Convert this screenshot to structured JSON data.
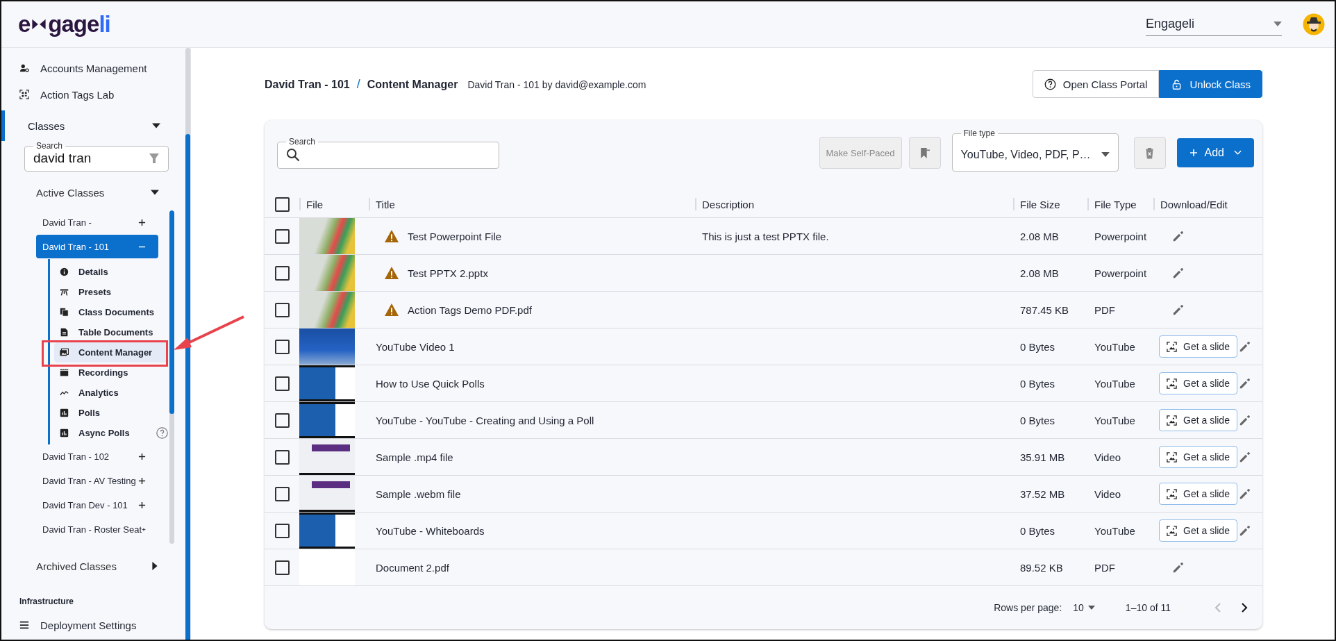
{
  "header": {
    "logo": {
      "start": "e",
      "middle": "gage",
      "end": "li"
    },
    "org_select": {
      "value": "Engageli"
    }
  },
  "sidebar": {
    "nav_items": [
      {
        "label": "Accounts Management"
      },
      {
        "label": "Action Tags Lab"
      }
    ],
    "classes": {
      "label": "Classes",
      "expanded": true,
      "selected": true,
      "search": {
        "label": "Search",
        "value": "david tran"
      },
      "active": {
        "label": "Active Classes",
        "expanded": true,
        "items": [
          {
            "label": "David Tran -",
            "expanded": false,
            "selected": false
          },
          {
            "label": "David Tran - 101",
            "expanded": true,
            "selected": true,
            "children": [
              {
                "label": "Details",
                "selected": false,
                "help": false
              },
              {
                "label": "Presets",
                "selected": false,
                "help": false
              },
              {
                "label": "Class Documents",
                "selected": false,
                "help": false
              },
              {
                "label": "Table Documents",
                "selected": false,
                "help": false
              },
              {
                "label": "Content Manager",
                "selected": true,
                "help": false
              },
              {
                "label": "Recordings",
                "selected": false,
                "help": false
              },
              {
                "label": "Analytics",
                "selected": false,
                "help": false
              },
              {
                "label": "Polls",
                "selected": false,
                "help": false
              },
              {
                "label": "Async Polls",
                "selected": false,
                "help": true
              }
            ]
          },
          {
            "label": "David Tran - 102",
            "expanded": false,
            "selected": false
          },
          {
            "label": "David Tran - AV Testing",
            "expanded": false,
            "selected": false
          },
          {
            "label": "David Tran Dev - 101",
            "expanded": false,
            "selected": false
          },
          {
            "label": "David Tran - Roster Seat",
            "expanded": false,
            "selected": false
          }
        ]
      },
      "archived": {
        "label": "Archived Classes",
        "expanded": false
      }
    },
    "section_heading": "Infrastructure",
    "bottom_items": [
      {
        "label": "Deployment Settings"
      }
    ]
  },
  "breadcrumb": {
    "parent": "David Tran - 101",
    "separator": "/",
    "current": "Content Manager",
    "subtitle": "David Tran - 101 by david@example.com"
  },
  "header_buttons": {
    "open_portal": "Open Class Portal",
    "unlock": "Unlock Class"
  },
  "toolbar": {
    "search": {
      "label": "Search"
    },
    "self_paced": {
      "label": "Make Self-Paced",
      "disabled": true
    },
    "file_type": {
      "label": "File type",
      "value": "YouTube, Video, PDF, P…"
    },
    "add": "Add"
  },
  "table": {
    "all_checked": false,
    "columns": [
      "File",
      "Title",
      "Description",
      "File Size",
      "File Type",
      "Download/Edit"
    ],
    "rows": [
      {
        "checked": false,
        "kind": "candy",
        "warning": true,
        "title": "Test Powerpoint File",
        "description": "This is just a test PPTX file.",
        "size": "2.08 MB",
        "type": "Powerpoint"
      },
      {
        "checked": false,
        "kind": "candy",
        "warning": true,
        "title": "Test PPTX 2.pptx",
        "size": "2.08 MB",
        "type": "Powerpoint"
      },
      {
        "checked": false,
        "kind": "candy",
        "warning": true,
        "title": "Action Tags Demo PDF.pdf",
        "size": "787.45 KB",
        "type": "PDF"
      },
      {
        "checked": false,
        "kind": "news",
        "warning": false,
        "title": "YouTube Video 1",
        "size": "0 Bytes",
        "type": "YouTube",
        "slide_button": "Get a slide"
      },
      {
        "checked": false,
        "kind": "slides",
        "warning": false,
        "title": "How to Use Quick Polls",
        "size": "0 Bytes",
        "type": "YouTube",
        "slide_button": "Get a slide"
      },
      {
        "checked": false,
        "kind": "slides",
        "warning": false,
        "title": "YouTube - YouTube - Creating and Using a Poll",
        "size": "0 Bytes",
        "type": "YouTube",
        "slide_button": "Get a slide"
      },
      {
        "checked": false,
        "kind": "screen",
        "warning": false,
        "title": "Sample .mp4 file",
        "size": "35.91 MB",
        "type": "Video",
        "slide_button": "Get a slide"
      },
      {
        "checked": false,
        "kind": "screen",
        "warning": false,
        "title": "Sample .webm file",
        "size": "37.52 MB",
        "type": "Video",
        "slide_button": "Get a slide"
      },
      {
        "checked": false,
        "kind": "slides",
        "warning": false,
        "title": "YouTube - Whiteboards",
        "size": "0 Bytes",
        "type": "YouTube",
        "slide_button": "Get a slide"
      },
      {
        "checked": false,
        "kind": "blank",
        "warning": false,
        "title": "Document 2.pdf",
        "size": "89.52 KB",
        "type": "PDF"
      }
    ]
  },
  "pagination": {
    "rows_label": "Rows per page:",
    "rows_value": "10",
    "range": "1–10 of 11"
  }
}
